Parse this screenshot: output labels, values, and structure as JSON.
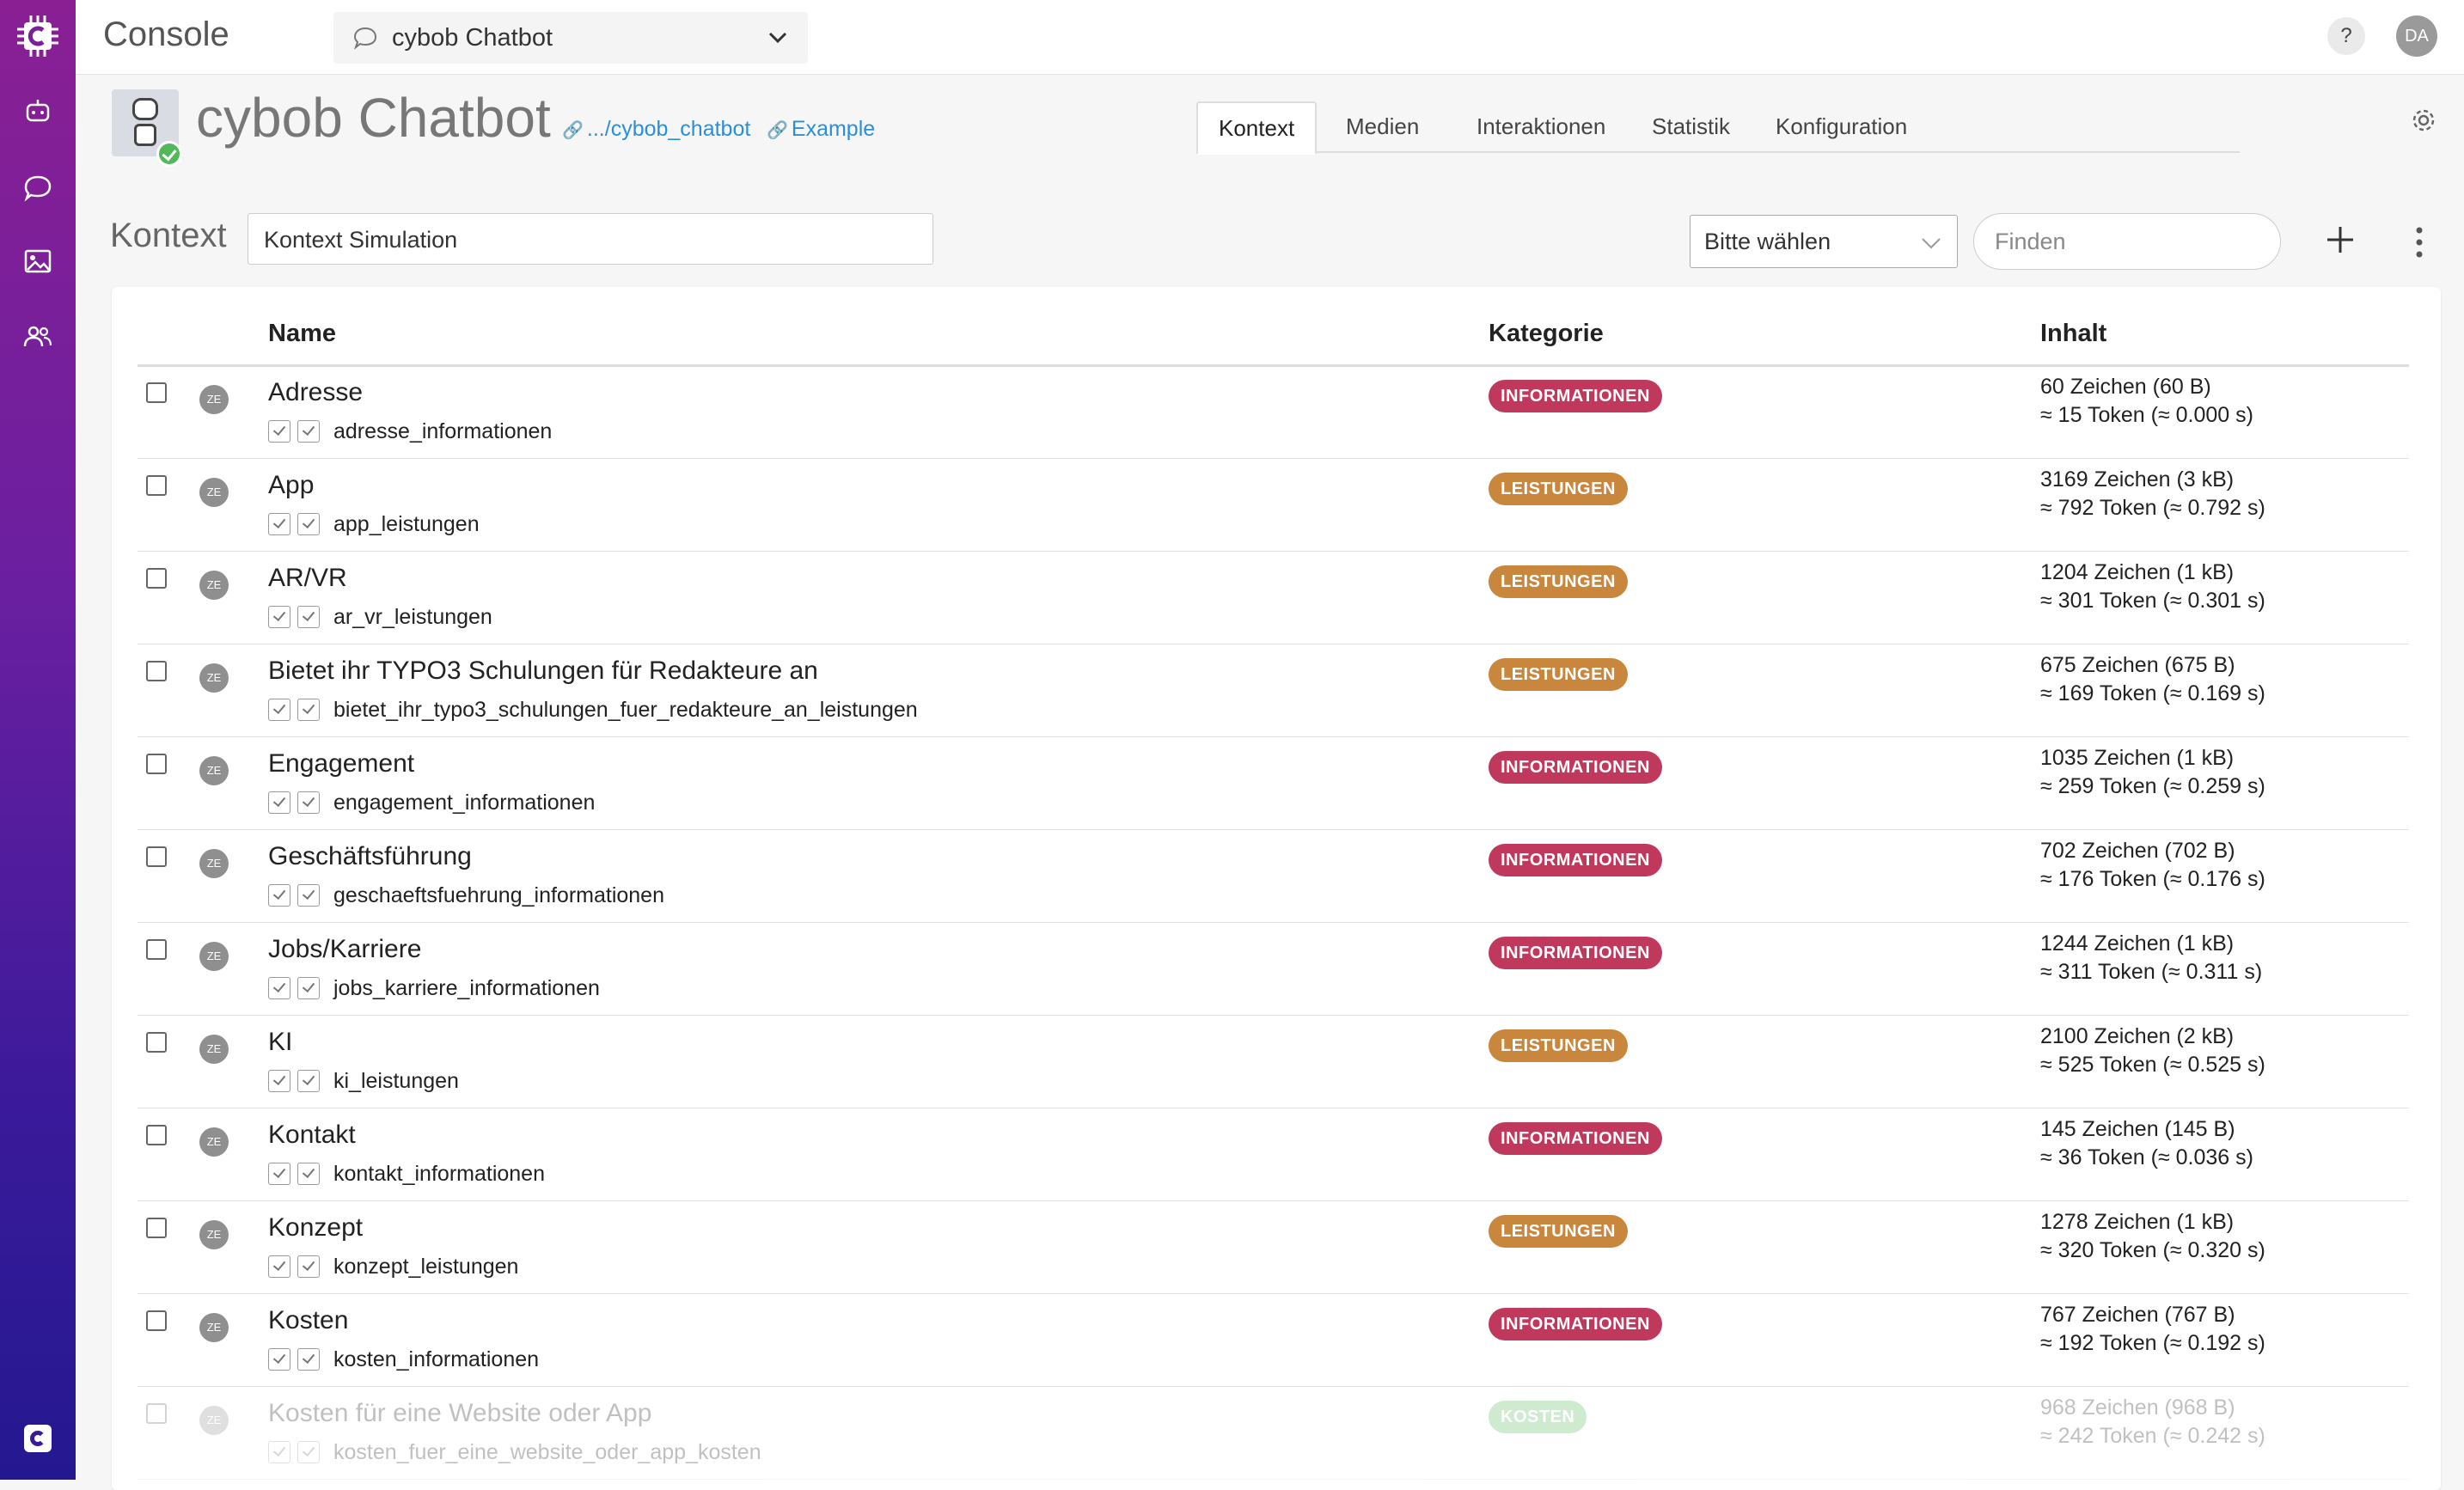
{
  "app": {
    "title": "Console"
  },
  "sidebar": {
    "items": [
      {
        "icon": "logo-icon"
      },
      {
        "icon": "robot-icon"
      },
      {
        "icon": "chat-bubble-icon"
      },
      {
        "icon": "image-icon"
      },
      {
        "icon": "users-icon"
      }
    ]
  },
  "topbar": {
    "bot_select": "cybob Chatbot",
    "help": "?",
    "user_initials": "DA"
  },
  "header": {
    "bot_name": "cybob Chatbot",
    "path_link": ".../cybob_chatbot",
    "example_link": "Example",
    "tabs": [
      "Kontext",
      "Medien",
      "Interaktionen",
      "Statistik",
      "Konfiguration"
    ],
    "active_tab": "Kontext"
  },
  "context": {
    "label": "Kontext",
    "input_value": "Kontext Simulation",
    "category_select": "Bitte wählen",
    "search_placeholder": "Finden"
  },
  "table": {
    "columns": [
      "Name",
      "Kategorie",
      "Inhalt"
    ],
    "rows": [
      {
        "name": "Adresse",
        "key": "adresse_informationen",
        "category": "INFORMATIONEN",
        "chars": "60 Zeichen (60 B)",
        "tokens": "≈ 15 Token (≈ 0.000 s)"
      },
      {
        "name": "App",
        "key": "app_leistungen",
        "category": "LEISTUNGEN",
        "chars": "3169 Zeichen (3 kB)",
        "tokens": "≈ 792 Token (≈ 0.792 s)"
      },
      {
        "name": "AR/VR",
        "key": "ar_vr_leistungen",
        "category": "LEISTUNGEN",
        "chars": "1204 Zeichen (1 kB)",
        "tokens": "≈ 301 Token (≈ 0.301 s)"
      },
      {
        "name": "Bietet ihr TYPO3 Schulungen für Redakteure an",
        "key": "bietet_ihr_typo3_schulungen_fuer_redakteure_an_leistungen",
        "category": "LEISTUNGEN",
        "chars": "675 Zeichen (675 B)",
        "tokens": "≈ 169 Token (≈ 0.169 s)"
      },
      {
        "name": "Engagement",
        "key": "engagement_informationen",
        "category": "INFORMATIONEN",
        "chars": "1035 Zeichen (1 kB)",
        "tokens": "≈ 259 Token (≈ 0.259 s)"
      },
      {
        "name": "Geschäftsführung",
        "key": "geschaeftsfuehrung_informationen",
        "category": "INFORMATIONEN",
        "chars": "702 Zeichen (702 B)",
        "tokens": "≈ 176 Token (≈ 0.176 s)"
      },
      {
        "name": "Jobs/Karriere",
        "key": "jobs_karriere_informationen",
        "category": "INFORMATIONEN",
        "chars": "1244 Zeichen (1 kB)",
        "tokens": "≈ 311 Token (≈ 0.311 s)"
      },
      {
        "name": "KI",
        "key": "ki_leistungen",
        "category": "LEISTUNGEN",
        "chars": "2100 Zeichen (2 kB)",
        "tokens": "≈ 525 Token (≈ 0.525 s)"
      },
      {
        "name": "Kontakt",
        "key": "kontakt_informationen",
        "category": "INFORMATIONEN",
        "chars": "145 Zeichen (145 B)",
        "tokens": "≈ 36 Token (≈ 0.036 s)"
      },
      {
        "name": "Konzept",
        "key": "konzept_leistungen",
        "category": "LEISTUNGEN",
        "chars": "1278 Zeichen (1 kB)",
        "tokens": "≈ 320 Token (≈ 0.320 s)"
      },
      {
        "name": "Kosten",
        "key": "kosten_informationen",
        "category": "INFORMATIONEN",
        "chars": "767 Zeichen (767 B)",
        "tokens": "≈ 192 Token (≈ 0.192 s)"
      },
      {
        "name": "Kosten für eine Website oder App",
        "key": "kosten_fuer_eine_website_oder_app_kosten",
        "category": "KOSTEN",
        "chars": "968 Zeichen (968 B)",
        "tokens": "≈ 242 Token (≈ 0.242 s)",
        "faded": true
      }
    ]
  },
  "colors": {
    "sidebar_top": "#8a1f94",
    "sidebar_bottom": "#241890",
    "badge_informationen": "#c0385c",
    "badge_leistungen": "#c8873c",
    "badge_kosten": "#52b85a",
    "link": "#2a8fd6"
  }
}
